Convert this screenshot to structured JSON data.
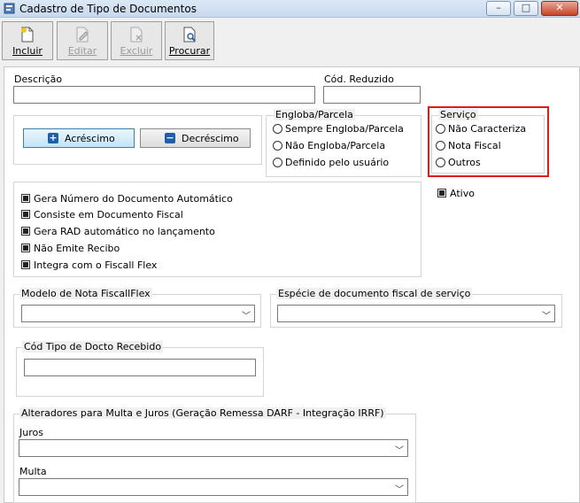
{
  "window": {
    "title": "Cadastro de Tipo de Documentos",
    "controls": {
      "minimize": "–",
      "maximize": "□",
      "close": "✕"
    }
  },
  "toolbar": {
    "incluir": "Incluir",
    "editar": "Editar",
    "excluir": "Excluir",
    "procurar": "Procurar"
  },
  "form": {
    "descricao_label": "Descrição",
    "descricao_value": "",
    "cod_reduzido_label": "Cód. Reduzido",
    "cod_reduzido_value": "",
    "acrescimo_label": "Acréscimo",
    "decrescimo_label": "Decréscimo",
    "engloba": {
      "title": "Engloba/Parcela",
      "options": [
        "Sempre Engloba/Parcela",
        "Não Engloba/Parcela",
        "Definido pelo usuário"
      ]
    },
    "servico": {
      "title": "Serviço",
      "options": [
        "Não Caracteriza",
        "Nota Fiscal",
        "Outros"
      ]
    },
    "checkboxes": [
      "Gera Número do Documento Automático",
      "Consiste em Documento Fiscal",
      "Gera RAD automático no lançamento",
      "Não Emite Recibo",
      "Integra com o Fiscall Flex"
    ],
    "ativo_label": "Ativo",
    "modelo_label": "Modelo de Nota FiscallFlex",
    "modelo_value": "",
    "especie_label": "Espécie de documento fiscal de serviço",
    "especie_value": "",
    "cod_tipo_label": "Cód Tipo de Docto Recebido",
    "cod_tipo_value": "",
    "alteradores_label": "Alteradores para Multa e Juros (Geração Remessa DARF - Integração IRRF)",
    "juros_label": "Juros",
    "juros_value": "",
    "multa_label": "Multa",
    "multa_value": "",
    "combo_arrow": "﹀"
  },
  "colors": {
    "highlight": "#e01b1b",
    "accent": "#3c7fb1"
  }
}
